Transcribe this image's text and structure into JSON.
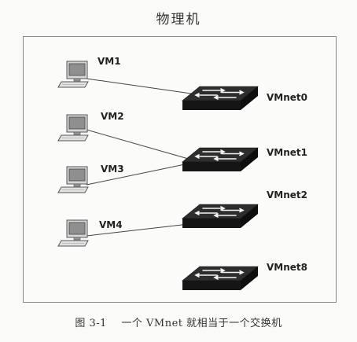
{
  "title": "物理机",
  "vms": [
    {
      "id": "vm1",
      "label": "VM1"
    },
    {
      "id": "vm2",
      "label": "VM2"
    },
    {
      "id": "vm3",
      "label": "VM3"
    },
    {
      "id": "vm4",
      "label": "VM4"
    }
  ],
  "switches": [
    {
      "id": "vmnet0",
      "label": "VMnet0"
    },
    {
      "id": "vmnet1",
      "label": "VMnet1"
    },
    {
      "id": "vmnet2",
      "label": "VMnet2"
    },
    {
      "id": "vmnet8",
      "label": "VMnet8"
    }
  ],
  "connections": [
    {
      "from": "vm1",
      "to": "vmnet0"
    },
    {
      "from": "vm2",
      "to": "vmnet1"
    },
    {
      "from": "vm3",
      "to": "vmnet1"
    },
    {
      "from": "vm4",
      "to": "vmnet2"
    }
  ],
  "caption": "图 3-1    一个 VMnet 就相当于一个交换机",
  "colors": {
    "switch_dark": "#1e1e1e",
    "switch_top": "#2a2a2a",
    "arrow": "#f2f2f2",
    "monitor_screen": "#9a9a9a",
    "line": "#444444"
  }
}
